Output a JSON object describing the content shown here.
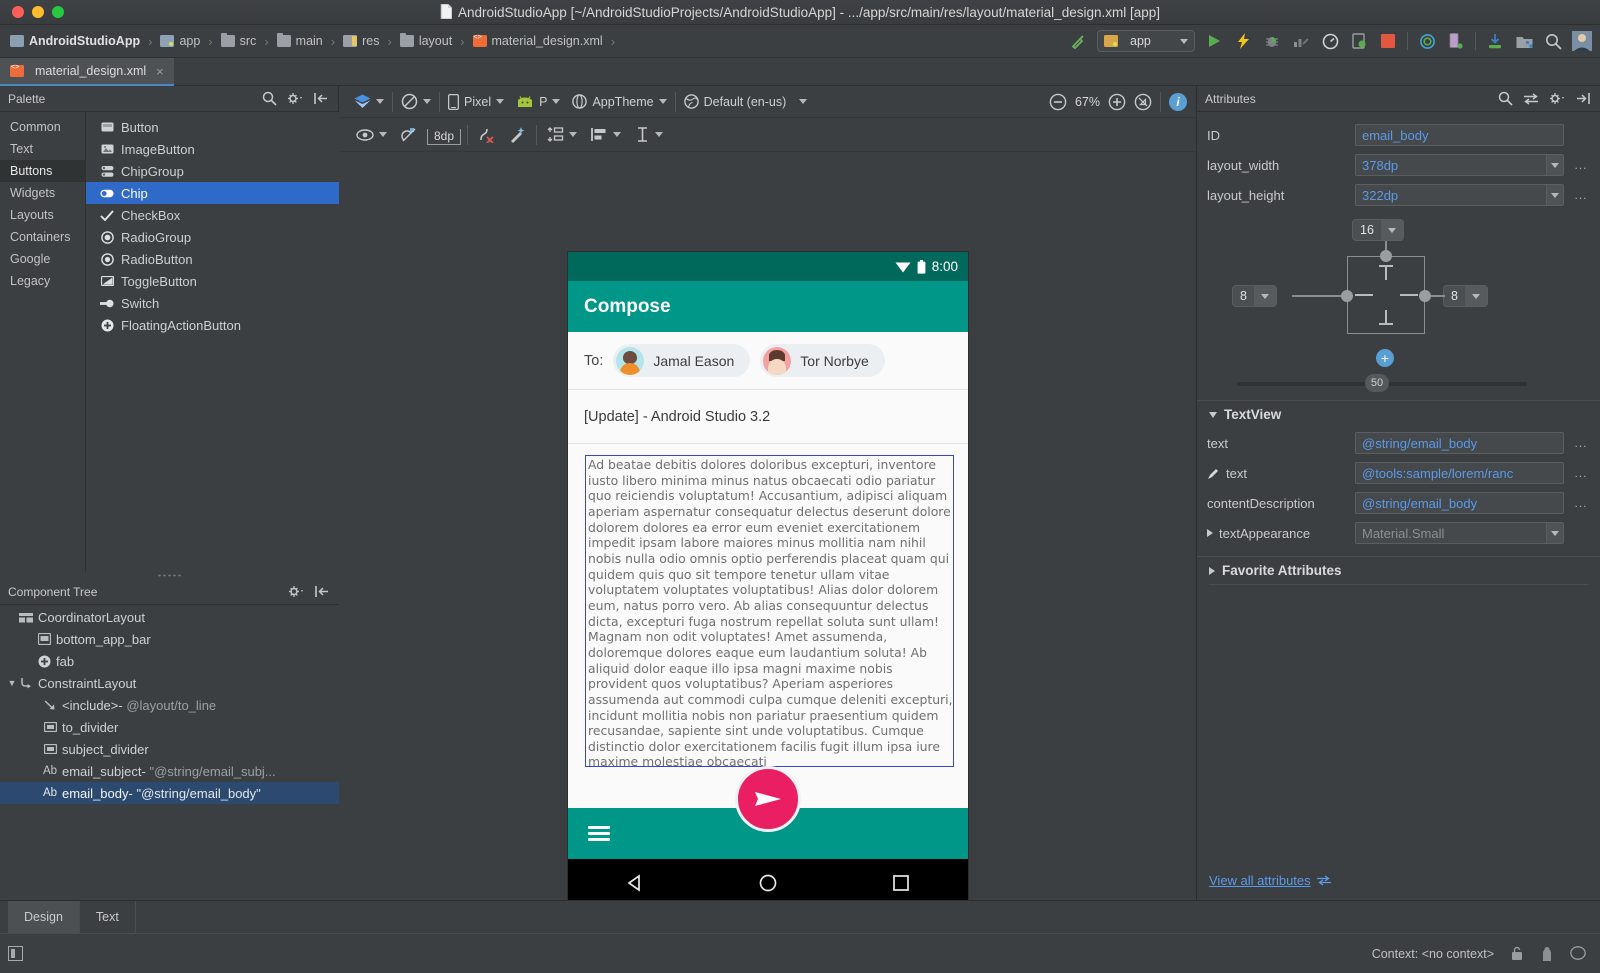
{
  "window": {
    "title": "AndroidStudioApp [~/AndroidStudioProjects/AndroidStudioApp] - .../app/src/main/res/layout/material_design.xml [app]",
    "doc_icon": "document-icon"
  },
  "breadcrumb": {
    "items": [
      {
        "label": "AndroidStudioApp",
        "icon": "project-icon"
      },
      {
        "label": "app",
        "icon": "module-icon"
      },
      {
        "label": "src",
        "icon": "folder-icon"
      },
      {
        "label": "main",
        "icon": "folder-icon"
      },
      {
        "label": "res",
        "icon": "res-folder-icon"
      },
      {
        "label": "layout",
        "icon": "folder-icon"
      },
      {
        "label": "material_design.xml",
        "icon": "xml-file-icon"
      }
    ],
    "separator": "›"
  },
  "toolbar_right": {
    "run_config_label": "app",
    "icons": [
      "build-hammer-icon",
      "run-icon",
      "instant-run-icon",
      "debug-icon",
      "profile-icon",
      "monitor-icon",
      "attach-debugger-icon",
      "stop-icon",
      "sync-gradle-icon",
      "avd-manager-icon",
      "sdk-manager-icon",
      "device-file-explorer-icon",
      "search-everywhere-icon",
      "avatar"
    ]
  },
  "editor_tab": {
    "label": "material_design.xml",
    "close": "×",
    "icon": "xml-file-icon"
  },
  "palette": {
    "title": "Palette",
    "actions": [
      "search-icon",
      "gear-icon",
      "collapse-icon"
    ],
    "categories": [
      {
        "label": "Common",
        "selected": false
      },
      {
        "label": "Text",
        "selected": false
      },
      {
        "label": "Buttons",
        "selected": true
      },
      {
        "label": "Widgets",
        "selected": false
      },
      {
        "label": "Layouts",
        "selected": false
      },
      {
        "label": "Containers",
        "selected": false
      },
      {
        "label": "Google",
        "selected": false
      },
      {
        "label": "Legacy",
        "selected": false
      }
    ],
    "items": [
      {
        "label": "Button",
        "icon": "button-icon",
        "selected": false
      },
      {
        "label": "ImageButton",
        "icon": "image-button-icon",
        "selected": false
      },
      {
        "label": "ChipGroup",
        "icon": "chip-group-icon",
        "selected": false
      },
      {
        "label": "Chip",
        "icon": "chip-icon",
        "selected": true
      },
      {
        "label": "CheckBox",
        "icon": "checkbox-icon",
        "selected": false
      },
      {
        "label": "RadioGroup",
        "icon": "radio-group-icon",
        "selected": false
      },
      {
        "label": "RadioButton",
        "icon": "radio-button-icon",
        "selected": false
      },
      {
        "label": "ToggleButton",
        "icon": "toggle-button-icon",
        "selected": false
      },
      {
        "label": "Switch",
        "icon": "switch-icon",
        "selected": false
      },
      {
        "label": "FloatingActionButton",
        "icon": "fab-icon",
        "selected": false
      }
    ]
  },
  "component_tree": {
    "title": "Component Tree",
    "actions": [
      "gear-icon",
      "collapse-icon"
    ],
    "nodes": [
      {
        "label": "CoordinatorLayout",
        "value": "",
        "indent": 0,
        "arrow": "",
        "icon": "coordinator-layout-icon",
        "selected": false
      },
      {
        "label": "bottom_app_bar",
        "value": "",
        "indent": 1,
        "arrow": "",
        "icon": "app-bar-icon",
        "selected": false
      },
      {
        "label": "fab",
        "value": "",
        "indent": 1,
        "arrow": "",
        "icon": "fab-icon",
        "selected": false
      },
      {
        "label": "ConstraintLayout",
        "value": "",
        "indent": 1,
        "arrow": "▼",
        "icon": "constraint-layout-icon",
        "selected": false
      },
      {
        "label": "<include>-",
        "value": "@layout/to_line",
        "indent": 2,
        "arrow": "",
        "icon": "include-icon",
        "selected": false
      },
      {
        "label": "to_divider",
        "value": "",
        "indent": 2,
        "arrow": "",
        "icon": "view-icon",
        "selected": false
      },
      {
        "label": "subject_divider",
        "value": "",
        "indent": 2,
        "arrow": "",
        "icon": "view-icon",
        "selected": false
      },
      {
        "label": "email_subject-",
        "value": "\"@string/email_subj...",
        "indent": 2,
        "arrow": "",
        "icon": "textview-icon",
        "selected": false
      },
      {
        "label": "email_body-",
        "value": "\"@string/email_body\"",
        "indent": 2,
        "arrow": "",
        "icon": "textview-icon",
        "selected": true
      }
    ],
    "textview_icon_label": "Ab"
  },
  "design_toolbar": {
    "design_mode_icon": "layers-icon",
    "orientation_icon": "rotate-icon",
    "device": "Pixel",
    "device_icon": "phone-icon",
    "api": "P",
    "api_icon": "android-icon",
    "theme": "AppTheme",
    "theme_icon": "theme-icon",
    "locale": "Default (en-us)",
    "locale_icon": "globe-icon",
    "zoom": "67%",
    "zoom_out_icon": "zoom-out-icon",
    "zoom_in_icon": "zoom-in-icon",
    "zoom_fit_icon": "zoom-fit-icon",
    "info_icon": "info-icon"
  },
  "constraint_toolbar": {
    "visibility_icon": "eye-icon",
    "autoconnect_icon": "autoconnect-off-icon",
    "default_margin": "8dp",
    "clear_constraints_icon": "clear-constraints-icon",
    "infer_constraints_icon": "infer-constraints-icon",
    "pack_icon": "pack-icon",
    "align_icon": "align-icon",
    "guidelines_icon": "guidelines-icon"
  },
  "device_preview": {
    "status_time": "8:00",
    "status_icons": [
      "wifi-icon",
      "battery-icon"
    ],
    "app_bar_title": "Compose",
    "to_label": "To:",
    "recipients": [
      {
        "name": "Jamal Eason",
        "avatar": "avatar-jamal"
      },
      {
        "name": "Tor Norbye",
        "avatar": "avatar-tor"
      }
    ],
    "subject": "[Update] - Android Studio 3.2",
    "body": "Ad beatae debitis dolores doloribus excepturi, inventore iusto libero minima minus natus obcaecati odio pariatur quo reiciendis voluptatum! Accusantium, adipisci aliquam aperiam aspernatur consequatur delectus deserunt dolore dolorem dolores ea error eum eveniet exercitationem impedit ipsam labore maiores minus mollitia nam nihil nobis nulla odio omnis optio perferendis placeat quam qui quidem quis quo sit tempore tenetur ullam vitae voluptatem voluptates voluptatibus! Alias dolor dolorem eum, natus porro vero. Ab alias consequuntur delectus dicta, excepturi fuga nostrum repellat soluta sunt ullam! Magnam non odit voluptates! Amet assumenda, doloremque dolores eaque eum laudantium soluta! Ab aliquid dolor eaque illo ipsa magni maxime nobis provident quos voluptatibus? Aperiam asperiores assumenda aut commodi culpa cumque deleniti excepturi, incidunt mollitia nobis non pariatur praesentium quidem recusandae, sapiente sint unde voluptatibus. Cumque distinctio dolor exercitationem facilis fugit illum ipsa iure maxime molestiae obcaecati",
    "menu_icon": "hamburger-icon",
    "fab_icon": "send-icon",
    "nav_back_icon": "nav-back-icon",
    "nav_home_icon": "nav-home-icon",
    "nav_recents_icon": "nav-recents-icon",
    "colors": {
      "primary": "#009688",
      "primary_dark": "#00695c",
      "accent": "#e91e63",
      "selection": "#3b47c4"
    }
  },
  "attributes": {
    "title": "Attributes",
    "actions": [
      "search-icon",
      "sort-icon",
      "gear-icon",
      "collapse-icon"
    ],
    "fields": [
      {
        "label": "ID",
        "value": "email_body",
        "type": "text",
        "dropdown": false,
        "ellipsis": false
      },
      {
        "label": "layout_width",
        "value": "378dp",
        "type": "combo",
        "dropdown": true,
        "ellipsis": true
      },
      {
        "label": "layout_height",
        "value": "322dp",
        "type": "combo",
        "dropdown": true,
        "ellipsis": true
      }
    ],
    "constraint_widget": {
      "margin_top": "16",
      "margin_left": "8",
      "margin_right": "8",
      "bias": "50",
      "add_constraint_icon": "add-constraint-icon"
    },
    "section_textview": {
      "label": "TextView",
      "expanded": true,
      "rows": [
        {
          "label": "text",
          "value": "@string/email_body",
          "icon": "",
          "type": "text",
          "dropdown": false,
          "ellipsis": true,
          "disabled": false
        },
        {
          "label": "text",
          "value": "@tools:sample/lorem/ranc",
          "icon": "design-time-icon",
          "type": "text",
          "dropdown": false,
          "ellipsis": true,
          "disabled": false
        },
        {
          "label": "contentDescription",
          "value": "@string/email_body",
          "icon": "",
          "type": "text",
          "dropdown": false,
          "ellipsis": true,
          "disabled": false
        },
        {
          "label": "textAppearance",
          "value": "Material.Small",
          "icon": "",
          "type": "combo",
          "dropdown": true,
          "ellipsis": false,
          "disabled": true,
          "expandable": true
        }
      ]
    },
    "section_favorites": {
      "label": "Favorite Attributes",
      "expanded": false
    },
    "view_all_label": "View all attributes"
  },
  "bottom_tabs": [
    {
      "label": "Design",
      "selected": true
    },
    {
      "label": "Text",
      "selected": false
    }
  ],
  "statusbar": {
    "left_icon": "toggle-tool-window-icon",
    "context": "Context: <no context>",
    "right_icons": [
      "lock-icon",
      "memory-icon",
      "event-log-icon"
    ]
  }
}
